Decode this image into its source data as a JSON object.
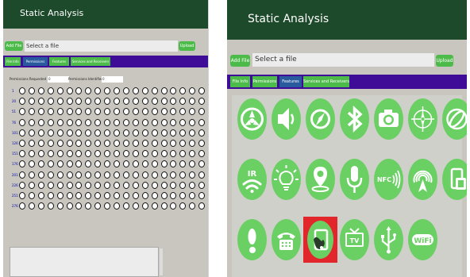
{
  "panel_left": {
    "title": "Static Analysis",
    "add_file": "Add File",
    "file_placeholder": "Select a file",
    "upload": "Upload",
    "tabs": [
      {
        "label": "File Info"
      },
      {
        "label": "Permissions"
      },
      {
        "label": "Features"
      },
      {
        "label": "Services and Receivers"
      }
    ],
    "active_tab": "Permissions",
    "requested_label": "Permissions Requested",
    "requested_value": "0",
    "identified_label": "Permissions Identified",
    "identified_value": "0",
    "row_labels": [
      "1",
      "20",
      "51",
      "76",
      "101",
      "126",
      "151",
      "176",
      "201",
      "226",
      "251",
      "276"
    ]
  },
  "panel_right": {
    "title": "Static Analysis",
    "add_file": "Add File",
    "file_placeholder": "Select a file",
    "upload": "Upload",
    "tabs": [
      {
        "label": "File Info"
      },
      {
        "label": "Permissions"
      },
      {
        "label": "Features"
      },
      {
        "label": "Services and Receivers"
      }
    ],
    "active_tab": "Features",
    "feature_icons": [
      "multi-connect-icon",
      "speaker-icon",
      "compass-icon",
      "bluetooth-icon",
      "camera-icon",
      "gps-compass-icon",
      "gyroscope-icon",
      "ir-icon",
      "light-sensor-icon",
      "location-icon",
      "microphone-icon",
      "nfc-icon",
      "wifi-signal-icon",
      "screen-rotation-icon",
      "step-counter-icon",
      "telephony-icon",
      "touchscreen-icon",
      "tv-icon",
      "usb-icon",
      "wifi-icon"
    ],
    "icon_labels": {
      "ir": "IR",
      "nfc": "NFC",
      "tv": "TV",
      "wifi": "WiFi"
    },
    "selected_icon": "touchscreen-icon"
  },
  "colors": {
    "title_bar": "#1d4a2a",
    "tab_bar": "#3f0c97",
    "button": "#4dbb4a",
    "active_tab": "#2a5a9e",
    "feature_circle": "#6bd064",
    "selection": "#e1272c",
    "panel_bg": "#c8c6be"
  }
}
